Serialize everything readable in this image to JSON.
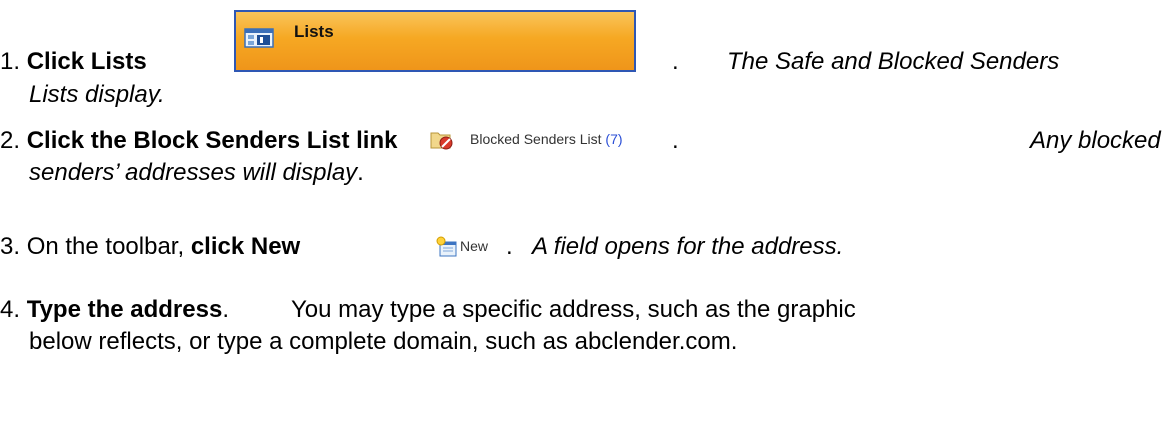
{
  "steps": [
    {
      "number": "1.",
      "action": "Click Lists",
      "after": ".",
      "result": "The Safe and Blocked Senders",
      "result_line2": "Lists display."
    },
    {
      "number": "2.",
      "action": "Click the Block Senders List link",
      "after": ".",
      "result": "Any blocked",
      "result_line2": "senders’ addresses will display",
      "result_line2_end": "."
    },
    {
      "number": "3.",
      "prefix": "On the toolbar,",
      "action": "click New",
      "after": ".",
      "result": "A field opens for the address."
    },
    {
      "number": "4.",
      "action": "Type the address",
      "after": ".",
      "text": "You may type a specific address, such as the graphic",
      "text_line2": "below reflects, or type a complete domain, such as abclender.com."
    }
  ],
  "lists_button": {
    "label": "Lists",
    "icon": "lists-icon"
  },
  "blocked_link": {
    "label": "Blocked Senders List",
    "count": "(7)",
    "icon": "blocked-folder-icon"
  },
  "new_button": {
    "label": "New",
    "icon": "new-item-icon"
  },
  "colors": {
    "button_border": "#2e57b4",
    "button_fill": "#f6a823",
    "link_count": "#2b4fd6"
  }
}
